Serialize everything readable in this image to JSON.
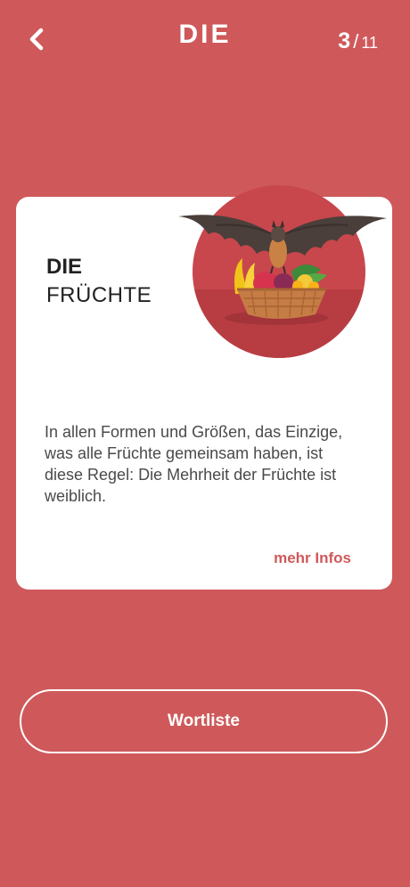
{
  "header": {
    "title": "DIE",
    "counter_current": "3",
    "counter_separator": "/",
    "counter_total": "11"
  },
  "card": {
    "article": "DIE",
    "noun": "FRÜCHTE",
    "description": "In allen Formen und Größen, das Einzige, was alle Früchte gemeinsam haben, ist diese Regel: Die Mehrheit der Früchte ist weiblich.",
    "more_link": "mehr Infos",
    "illustration_icon": "bat-fruit-basket-illustration"
  },
  "wordlist_button": {
    "label": "Wortliste"
  },
  "colors": {
    "background": "#cf595a",
    "card": "#ffffff",
    "accent": "#cf595a",
    "circle": "#c8474c"
  }
}
